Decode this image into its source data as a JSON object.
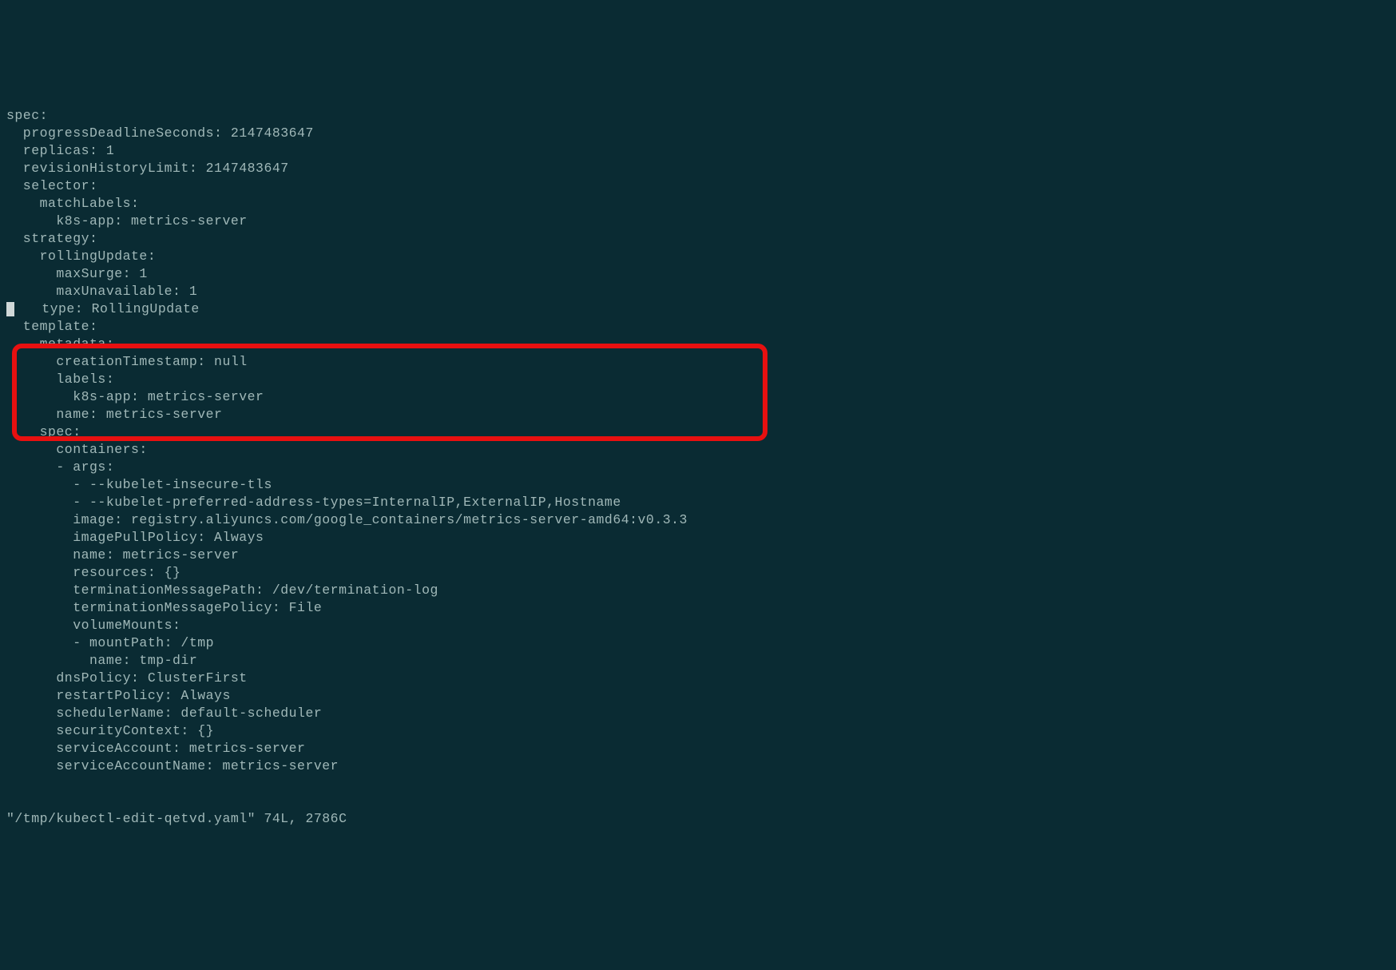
{
  "lines": [
    "spec:",
    "  progressDeadlineSeconds: 2147483647",
    "  replicas: 1",
    "  revisionHistoryLimit: 2147483647",
    "  selector:",
    "    matchLabels:",
    "      k8s-app: metrics-server",
    "  strategy:",
    "    rollingUpdate:",
    "      maxSurge: 1",
    "      maxUnavailable: 1",
    "    type: RollingUpdate",
    "  template:",
    "    metadata:",
    "      creationTimestamp: null",
    "      labels:",
    "        k8s-app: metrics-server",
    "      name: metrics-server",
    "    spec:",
    "      containers:",
    "      - args:",
    "        - --kubelet-insecure-tls",
    "        - --kubelet-preferred-address-types=InternalIP,ExternalIP,Hostname",
    "        image: registry.aliyuncs.com/google_containers/metrics-server-amd64:v0.3.3",
    "        imagePullPolicy: Always",
    "        name: metrics-server",
    "        resources: {}",
    "        terminationMessagePath: /dev/termination-log",
    "        terminationMessagePolicy: File",
    "        volumeMounts:",
    "        - mountPath: /tmp",
    "          name: tmp-dir",
    "      dnsPolicy: ClusterFirst",
    "      restartPolicy: Always",
    "      schedulerName: default-scheduler",
    "      securityContext: {}",
    "      serviceAccount: metrics-server",
    "      serviceAccountName: metrics-server"
  ],
  "cursor_line_index": 11,
  "status": "\"/tmp/kubectl-edit-qetvd.yaml\" 74L, 2786C"
}
